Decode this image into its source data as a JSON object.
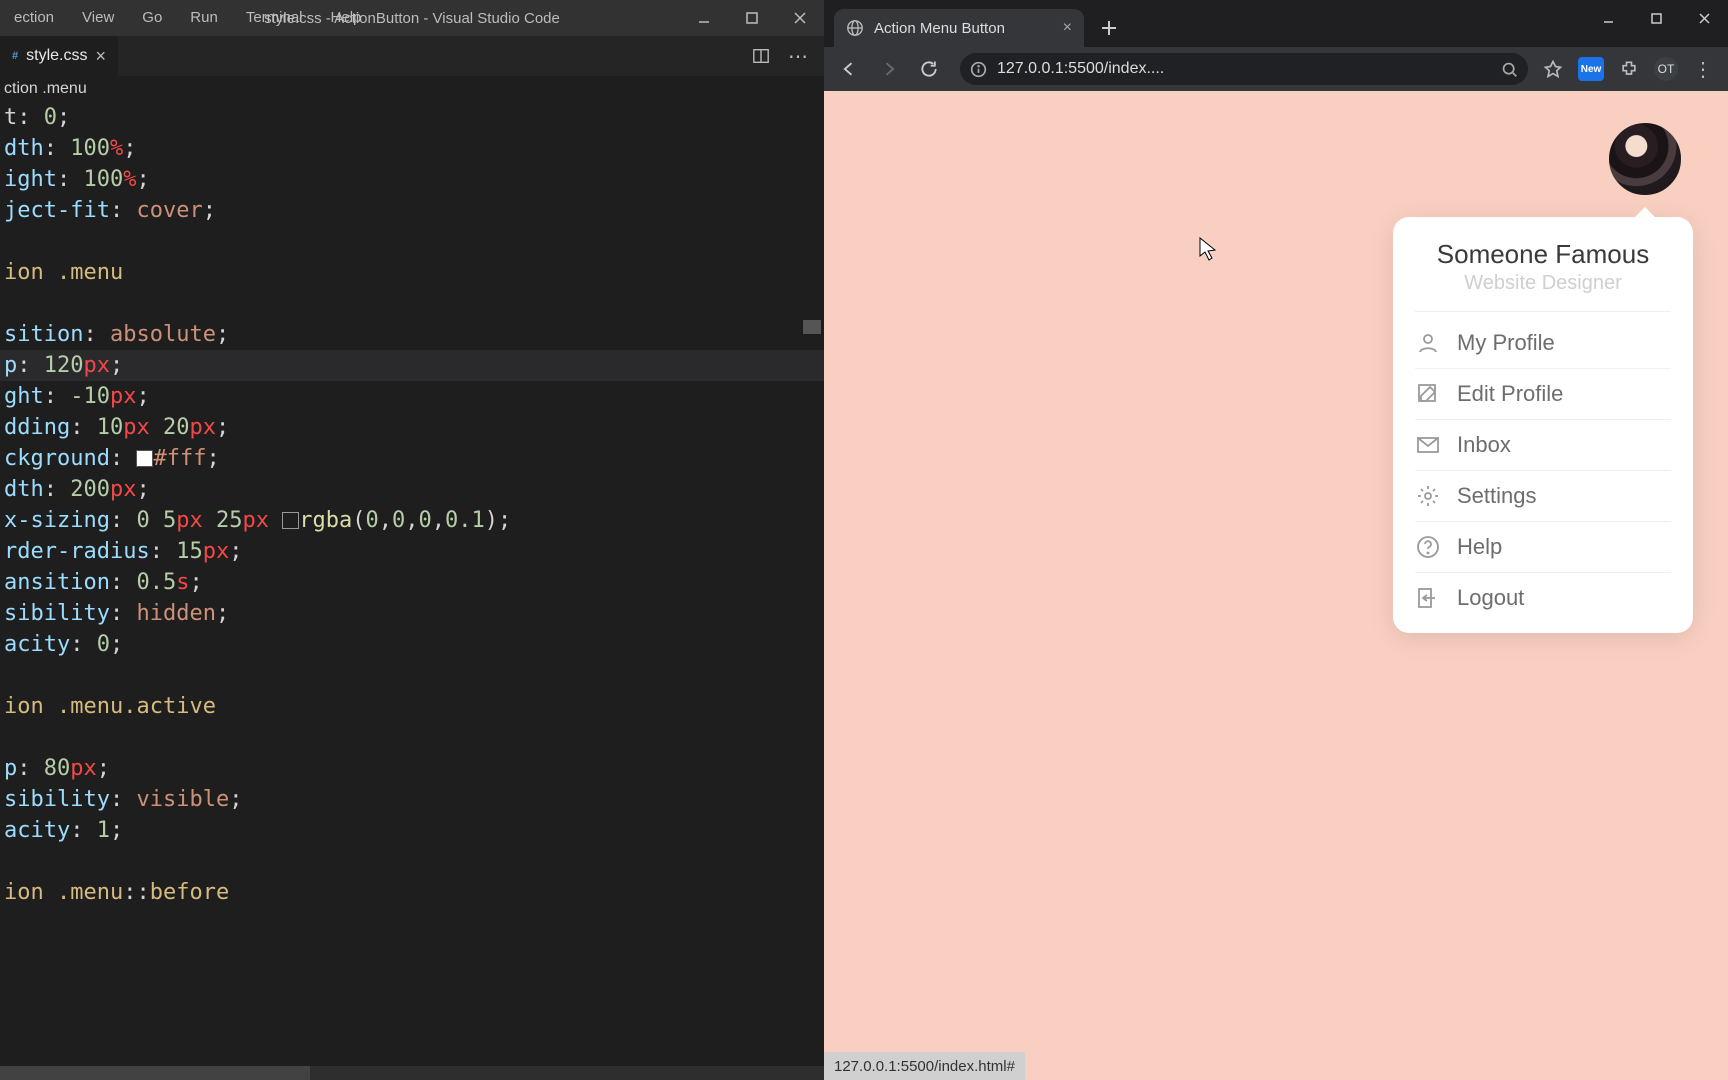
{
  "vscode": {
    "menu": [
      "ection",
      "View",
      "Go",
      "Run",
      "Terminal",
      "Help"
    ],
    "title": "style.css - ActionButton - Visual Studio Code",
    "tab": {
      "label": "style.css"
    },
    "breadcrumb": "ction .menu",
    "lines": [
      {
        "type": "prop",
        "prop": "t",
        "val_raw": ": 0;",
        "segs": [
          [
            "punc",
            "t"
          ],
          [
            "punc",
            ": "
          ],
          [
            "num",
            "0"
          ],
          [
            "punc",
            ";"
          ]
        ]
      },
      {
        "type": "prop",
        "segs": [
          [
            "prop",
            "dth"
          ],
          [
            "punc",
            ": "
          ],
          [
            "num",
            "100"
          ],
          [
            "kw",
            "%"
          ],
          [
            "punc",
            ";"
          ]
        ]
      },
      {
        "type": "prop",
        "segs": [
          [
            "prop",
            "ight"
          ],
          [
            "punc",
            ": "
          ],
          [
            "num",
            "100"
          ],
          [
            "kw",
            "%"
          ],
          [
            "punc",
            ";"
          ]
        ]
      },
      {
        "type": "prop",
        "segs": [
          [
            "prop",
            "ject-fit"
          ],
          [
            "punc",
            ": "
          ],
          [
            "val",
            "cover"
          ],
          [
            "punc",
            ";"
          ]
        ]
      },
      {
        "type": "blank"
      },
      {
        "type": "sel",
        "segs": [
          [
            "sel",
            "ion "
          ],
          [
            "dot",
            "."
          ],
          [
            "sel",
            "menu"
          ]
        ]
      },
      {
        "type": "blank"
      },
      {
        "type": "prop",
        "segs": [
          [
            "prop",
            "sition"
          ],
          [
            "punc",
            ": "
          ],
          [
            "val",
            "absolute"
          ],
          [
            "punc",
            ";"
          ]
        ]
      },
      {
        "type": "prop",
        "active": true,
        "segs": [
          [
            "prop",
            "p"
          ],
          [
            "punc",
            ": "
          ],
          [
            "num",
            "120"
          ],
          [
            "kw",
            "px"
          ],
          [
            "punc",
            ";"
          ]
        ]
      },
      {
        "type": "prop",
        "segs": [
          [
            "prop",
            "ght"
          ],
          [
            "punc",
            ": "
          ],
          [
            "num",
            "-10"
          ],
          [
            "kw",
            "px"
          ],
          [
            "punc",
            ";"
          ]
        ]
      },
      {
        "type": "prop",
        "segs": [
          [
            "prop",
            "dding"
          ],
          [
            "punc",
            ": "
          ],
          [
            "num",
            "10"
          ],
          [
            "kw",
            "px"
          ],
          [
            "punc",
            " "
          ],
          [
            "num",
            "20"
          ],
          [
            "kw",
            "px"
          ],
          [
            "punc",
            ";"
          ]
        ]
      },
      {
        "type": "prop",
        "segs": [
          [
            "prop",
            "ckground"
          ],
          [
            "punc",
            ": "
          ],
          [
            "swatch",
            "#fff"
          ],
          [
            "val",
            "#fff"
          ],
          [
            "punc",
            ";"
          ]
        ]
      },
      {
        "type": "prop",
        "segs": [
          [
            "prop",
            "dth"
          ],
          [
            "punc",
            ": "
          ],
          [
            "num",
            "200"
          ],
          [
            "kw",
            "px"
          ],
          [
            "punc",
            ";"
          ]
        ]
      },
      {
        "type": "prop",
        "segs": [
          [
            "prop",
            "x-sizing"
          ],
          [
            "punc",
            ": "
          ],
          [
            "num",
            "0"
          ],
          [
            "punc",
            " "
          ],
          [
            "num",
            "5"
          ],
          [
            "kw",
            "px"
          ],
          [
            "punc",
            " "
          ],
          [
            "num",
            "25"
          ],
          [
            "kw",
            "px"
          ],
          [
            "punc",
            " "
          ],
          [
            "swatch",
            "transparent"
          ],
          [
            "func",
            "rgba"
          ],
          [
            "punc",
            "("
          ],
          [
            "num",
            "0"
          ],
          [
            "punc",
            ","
          ],
          [
            "num",
            "0"
          ],
          [
            "punc",
            ","
          ],
          [
            "num",
            "0"
          ],
          [
            "punc",
            ","
          ],
          [
            "num",
            "0.1"
          ],
          [
            "punc",
            ")"
          ],
          [
            "punc",
            ";"
          ]
        ]
      },
      {
        "type": "prop",
        "segs": [
          [
            "prop",
            "rder-radius"
          ],
          [
            "punc",
            ": "
          ],
          [
            "num",
            "15"
          ],
          [
            "kw",
            "px"
          ],
          [
            "punc",
            ";"
          ]
        ]
      },
      {
        "type": "prop",
        "segs": [
          [
            "prop",
            "ansition"
          ],
          [
            "punc",
            ": "
          ],
          [
            "num",
            "0.5"
          ],
          [
            "kw",
            "s"
          ],
          [
            "punc",
            ";"
          ]
        ]
      },
      {
        "type": "prop",
        "segs": [
          [
            "prop",
            "sibility"
          ],
          [
            "punc",
            ": "
          ],
          [
            "val",
            "hidden"
          ],
          [
            "punc",
            ";"
          ]
        ]
      },
      {
        "type": "prop",
        "segs": [
          [
            "prop",
            "acity"
          ],
          [
            "punc",
            ": "
          ],
          [
            "num",
            "0"
          ],
          [
            "punc",
            ";"
          ]
        ]
      },
      {
        "type": "blank"
      },
      {
        "type": "sel",
        "segs": [
          [
            "sel",
            "ion "
          ],
          [
            "dot",
            "."
          ],
          [
            "sel",
            "menu"
          ],
          [
            "dot",
            "."
          ],
          [
            "sel",
            "active"
          ]
        ]
      },
      {
        "type": "blank"
      },
      {
        "type": "prop",
        "segs": [
          [
            "prop",
            "p"
          ],
          [
            "punc",
            ": "
          ],
          [
            "num",
            "80"
          ],
          [
            "kw",
            "px"
          ],
          [
            "punc",
            ";"
          ]
        ]
      },
      {
        "type": "prop",
        "segs": [
          [
            "prop",
            "sibility"
          ],
          [
            "punc",
            ": "
          ],
          [
            "val",
            "visible"
          ],
          [
            "punc",
            ";"
          ]
        ]
      },
      {
        "type": "prop",
        "segs": [
          [
            "prop",
            "acity"
          ],
          [
            "punc",
            ": "
          ],
          [
            "num",
            "1"
          ],
          [
            "punc",
            ";"
          ]
        ]
      },
      {
        "type": "blank"
      },
      {
        "type": "sel",
        "segs": [
          [
            "sel",
            "ion "
          ],
          [
            "dot",
            "."
          ],
          [
            "sel",
            "menu"
          ],
          [
            "punc",
            "::"
          ],
          [
            "sel",
            "before"
          ]
        ]
      }
    ]
  },
  "chrome": {
    "tab_title": "Action Menu Button",
    "url": "127.0.0.1:5500/index....",
    "profile_initials": "OT",
    "new_badge": "New",
    "status": "127.0.0.1:5500/index.html#"
  },
  "menu": {
    "name": "Someone Famous",
    "role": "Website Designer",
    "items": [
      {
        "icon": "user",
        "label": "My Profile"
      },
      {
        "icon": "edit",
        "label": "Edit Profile"
      },
      {
        "icon": "mail",
        "label": "Inbox"
      },
      {
        "icon": "gear",
        "label": "Settings"
      },
      {
        "icon": "help",
        "label": "Help"
      },
      {
        "icon": "logout",
        "label": "Logout"
      }
    ]
  }
}
